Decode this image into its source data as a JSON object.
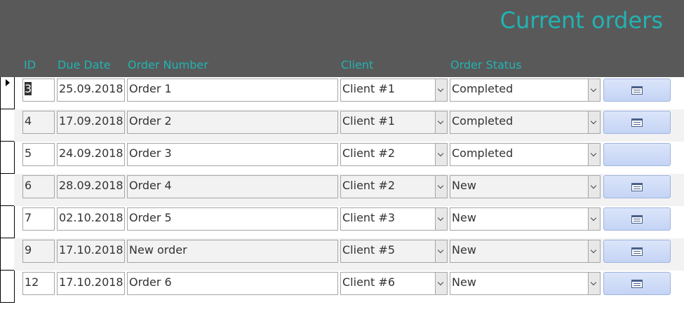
{
  "title": "Current orders",
  "columns": {
    "id": "ID",
    "due_date": "Due Date",
    "order_number": "Order Number",
    "client": "Client",
    "order_status": "Order Status"
  },
  "rows": [
    {
      "id": "3",
      "due_date": "25.09.2018",
      "order_number": "Order 1",
      "client": "Client #1",
      "status": "Completed",
      "has_icon": true
    },
    {
      "id": "4",
      "due_date": "17.09.2018",
      "order_number": "Order 2",
      "client": "Client #1",
      "status": "Completed",
      "has_icon": true
    },
    {
      "id": "5",
      "due_date": "24.09.2018",
      "order_number": "Order 3",
      "client": "Client #2",
      "status": "Completed",
      "has_icon": false
    },
    {
      "id": "6",
      "due_date": "28.09.2018",
      "order_number": "Order 4",
      "client": "Client #2",
      "status": "New",
      "has_icon": true
    },
    {
      "id": "7",
      "due_date": "02.10.2018",
      "order_number": "Order 5",
      "client": "Client #3",
      "status": "New",
      "has_icon": true
    },
    {
      "id": "9",
      "due_date": "17.10.2018",
      "order_number": "New order",
      "client": "Client #5",
      "status": "New",
      "has_icon": true
    },
    {
      "id": "12",
      "due_date": "17.10.2018",
      "order_number": "Order 6",
      "client": "Client #6",
      "status": "New",
      "has_icon": true
    }
  ],
  "colors": {
    "header_bg": "#595959",
    "accent": "#22b3b3",
    "alt_row": "#f2f2f2",
    "button": "#c5d4f5"
  },
  "icons": {
    "row_button": "form-icon",
    "record_selector": "record-selector-arrow-icon",
    "dropdown": "chevron-down-icon"
  }
}
